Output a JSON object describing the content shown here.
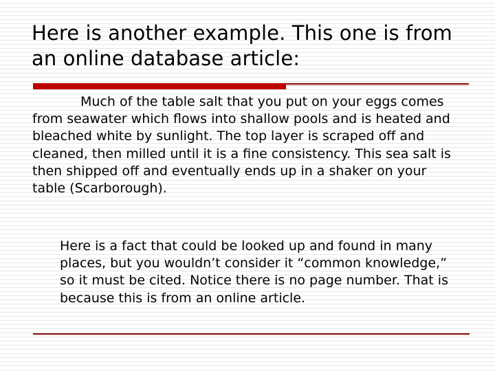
{
  "slide": {
    "title": "Here is another example.  This one is from an online database article:",
    "divider": {
      "accent_color": "#c00000",
      "line_color": "#8b1818"
    },
    "paragraphs": [
      {
        "id": "quote-block",
        "text": "Much of the table salt that you put on your eggs comes from seawater which flows into shallow pools and is heated and bleached white by sunlight. The top layer is scraped off and cleaned, then milled until it is a fine consistency.  This sea salt is then shipped off and eventually ends up in a shaker on your table (Scarborough)."
      },
      {
        "id": "commentary-block",
        "text": "Here is a fact that could be looked up and found in many places, but you wouldn’t consider it “common knowledge,” so it must be cited.  Notice there is no page number.  That is because this is from an online article."
      }
    ],
    "background_color": "#ffffff",
    "text_color": "#000000"
  }
}
